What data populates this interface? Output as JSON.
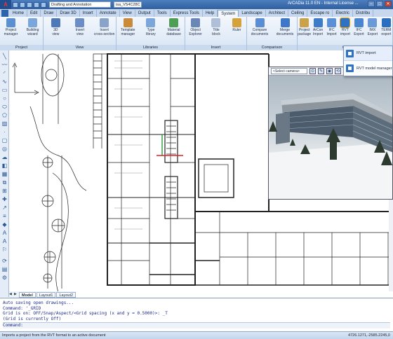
{
  "titlebar": {
    "logo": "A",
    "workspace": "Drafting and Annotation",
    "file_combo": "isa_VS4C28C",
    "title": "ArCADia 11.0 EN - Internal License ...",
    "min": "–",
    "max": "□",
    "close": "✕"
  },
  "menu": {
    "file": "",
    "tabs": [
      "Home",
      "Edit",
      "Draw",
      "Draw 3D",
      "Insert",
      "Annotate",
      "View",
      "Output",
      "Tools",
      "Express Tools",
      "Help",
      "System",
      "Landscape",
      "Architect",
      "Ceiling",
      "Escape ro",
      "Electric",
      "Distribu"
    ],
    "active": "System"
  },
  "ribbon": {
    "groups": [
      {
        "label": "Project",
        "buttons": [
          {
            "label": "Project\nmanager",
            "icon": "project-manager-icon",
            "color": "#5a8fd1"
          },
          {
            "label": "Building\nwizard",
            "icon": "building-wizard-icon",
            "color": "#7aa6dc"
          }
        ]
      },
      {
        "label": "View",
        "buttons": [
          {
            "label": "3D\nview",
            "icon": "3d-view-icon",
            "color": "#4d79b8"
          },
          {
            "label": "Insert\nview",
            "icon": "insert-view-icon",
            "color": "#6b8cc4"
          },
          {
            "label": "Insert\ncross-section",
            "icon": "cross-section-icon",
            "color": "#8aa4c9"
          }
        ]
      },
      {
        "label": "Libraries",
        "buttons": [
          {
            "label": "Template\nmanager",
            "icon": "template-manager-icon",
            "color": "#c98a3a"
          },
          {
            "label": "Type\nlibrary",
            "icon": "type-library-icon",
            "color": "#7aa6dc"
          },
          {
            "label": "Material\ndatabase",
            "icon": "material-database-icon",
            "color": "#4f9e55"
          }
        ]
      },
      {
        "label": "Insert",
        "buttons": [
          {
            "label": "Object\nExplorer",
            "icon": "object-explorer-icon",
            "color": "#6a86b6"
          },
          {
            "label": "Title\nblock",
            "icon": "title-block-icon",
            "color": "#b0bfd8"
          },
          {
            "label": "Ruler",
            "icon": "ruler-icon",
            "color": "#d4a23a"
          }
        ]
      },
      {
        "label": "Comparison",
        "buttons": [
          {
            "label": "Compare\ndocuments",
            "icon": "compare-documents-icon",
            "color": "#5b8dd4"
          },
          {
            "label": "Merge\ndocuments",
            "icon": "merge-documents-icon",
            "color": "#3f77c8"
          }
        ]
      },
      {
        "label": "Ce",
        "buttons": [
          {
            "label": "Project\npackage",
            "icon": "project-package-icon",
            "color": "#c9a24a"
          },
          {
            "label": "ArCon\nImport",
            "icon": "arcon-import-icon",
            "color": "#3c7cc9"
          },
          {
            "label": "IFC\nImport",
            "icon": "ifc-import-icon",
            "color": "#5a90d8"
          },
          {
            "label": "RVT\nimport",
            "icon": "rvt-import-icon",
            "color": "#2f72c4"
          },
          {
            "label": "IFC\nExport",
            "icon": "ifc-export-icon",
            "color": "#4a86d0"
          },
          {
            "label": "IMX\nExport",
            "icon": "imx-export-icon",
            "color": "#6a9ad8"
          },
          {
            "label": "TERM\nexport",
            "icon": "term-export-icon",
            "color": "#2a6fbf"
          }
        ]
      }
    ]
  },
  "dropdown": {
    "items": [
      "RVT import",
      "RVT model manager"
    ]
  },
  "render": {
    "camera": "<Select camera>",
    "buttons": [
      "⊙",
      "✎",
      "◉",
      "⟲"
    ]
  },
  "layout_tabs": [
    "Model",
    "Layout1",
    "Layout2"
  ],
  "command": {
    "lines": [
      "Auto saving open drawings...",
      "Command: '_GRID",
      "Grid is on:  OFF/Snap/Aspect/<Grid spacing (x and y = 0.5000)>: _T",
      "(Grid is currently Off)"
    ],
    "prompt": "Command:"
  },
  "status": {
    "message": "Imports a project from the RVT format to an active document",
    "coords": "4726.1271,-2585.2245,0"
  }
}
